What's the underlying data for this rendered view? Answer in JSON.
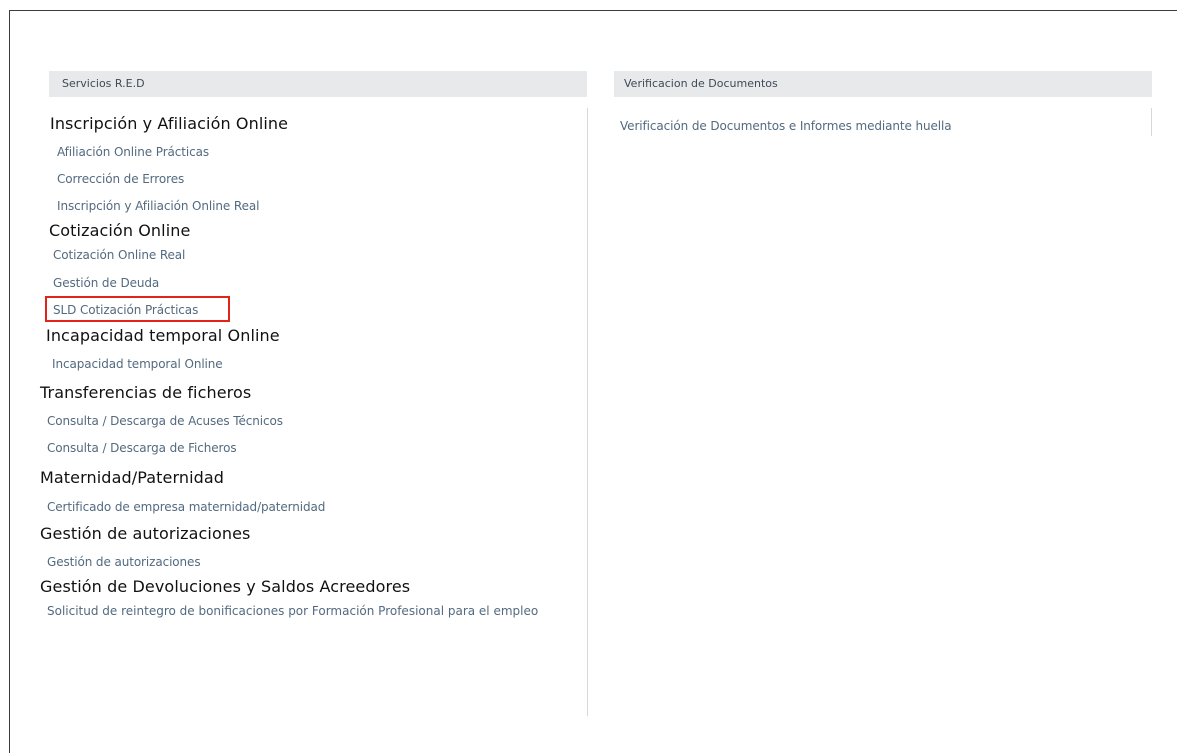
{
  "left_panel": {
    "header": "Servicios R.E.D",
    "sections": [
      {
        "heading": "Inscripción y Afiliación Online",
        "items": [
          "Afiliación Online Prácticas",
          "Corrección de Errores",
          "Inscripción y Afiliación Online Real"
        ]
      },
      {
        "heading": "Cotización Online",
        "items": [
          "Cotización Online Real",
          "Gestión de Deuda",
          "SLD Cotización Prácticas"
        ]
      },
      {
        "heading": "Incapacidad temporal Online",
        "items": [
          "Incapacidad temporal Online"
        ]
      },
      {
        "heading": "Transferencias de ficheros",
        "items": [
          "Consulta / Descarga de Acuses Técnicos",
          "Consulta / Descarga de Ficheros"
        ]
      },
      {
        "heading": "Maternidad/Paternidad",
        "items": [
          "Certificado de empresa maternidad/paternidad"
        ]
      },
      {
        "heading": "Gestión de autorizaciones",
        "items": [
          "Gestión de autorizaciones"
        ]
      },
      {
        "heading": "Gestión de Devoluciones y Saldos Acreedores",
        "items": [
          "Solicitud de reintegro de bonificaciones por Formación Profesional para el empleo"
        ]
      }
    ]
  },
  "right_panel": {
    "header": "Verificacion de Documentos",
    "items": [
      "Verificación de Documentos e Informes mediante huella"
    ]
  },
  "colors": {
    "header_bg": "#e7e9eb",
    "link": "#536a7f",
    "heading": "#111111",
    "highlight": "#e2231a"
  }
}
